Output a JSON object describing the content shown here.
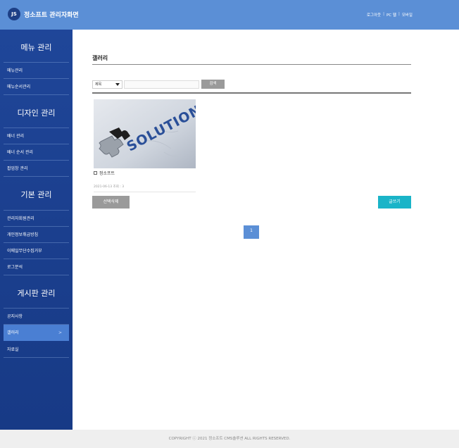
{
  "header": {
    "logo_text": "JS",
    "title": "정소프트 관리자화면",
    "links": [
      "로그아웃",
      "PC 웹",
      "모바일"
    ],
    "bg_color": "#5b8fd6"
  },
  "sidebar": {
    "groups": [
      {
        "title": "메뉴 관리",
        "items": [
          {
            "label": "메뉴관리"
          },
          {
            "label": "메뉴순서관리"
          }
        ]
      },
      {
        "title": "디자인 관리",
        "items": [
          {
            "label": "배너 관리"
          },
          {
            "label": "배너 순서 관리"
          },
          {
            "label": "팝업창 관리"
          }
        ]
      },
      {
        "title": "기본 관리",
        "items": [
          {
            "label": "관리자회원관리"
          },
          {
            "label": "개인정보취급방침"
          },
          {
            "label": "이메일무단수집거부"
          },
          {
            "label": "로그분석"
          }
        ]
      },
      {
        "title": "게시판 관리",
        "items": [
          {
            "label": "공지사항"
          },
          {
            "label": "갤러리",
            "active": true,
            "arrow": ">"
          },
          {
            "label": "자료실"
          }
        ]
      }
    ],
    "bg_color": "#1d4292",
    "active_color": "#4a7fd3"
  },
  "main": {
    "title": "갤러리",
    "search": {
      "select_value": "제목",
      "input_value": "",
      "button_label": "검색"
    },
    "gallery_items": [
      {
        "title": "정소프트",
        "meta": "2021-06-13 조회 : 3",
        "image_text": "SOLUTION",
        "image_icon": "puzzle-piece-icon"
      }
    ],
    "delete_button": "선택삭제",
    "write_button": "글쓰기",
    "write_color": "#1ab4c8",
    "pagination": {
      "current": "1"
    }
  },
  "footer": {
    "text": "COPYRIGHT ⓒ 2021 정소프트 CMS솔루션 ALL RIGHTS RESERVED."
  }
}
